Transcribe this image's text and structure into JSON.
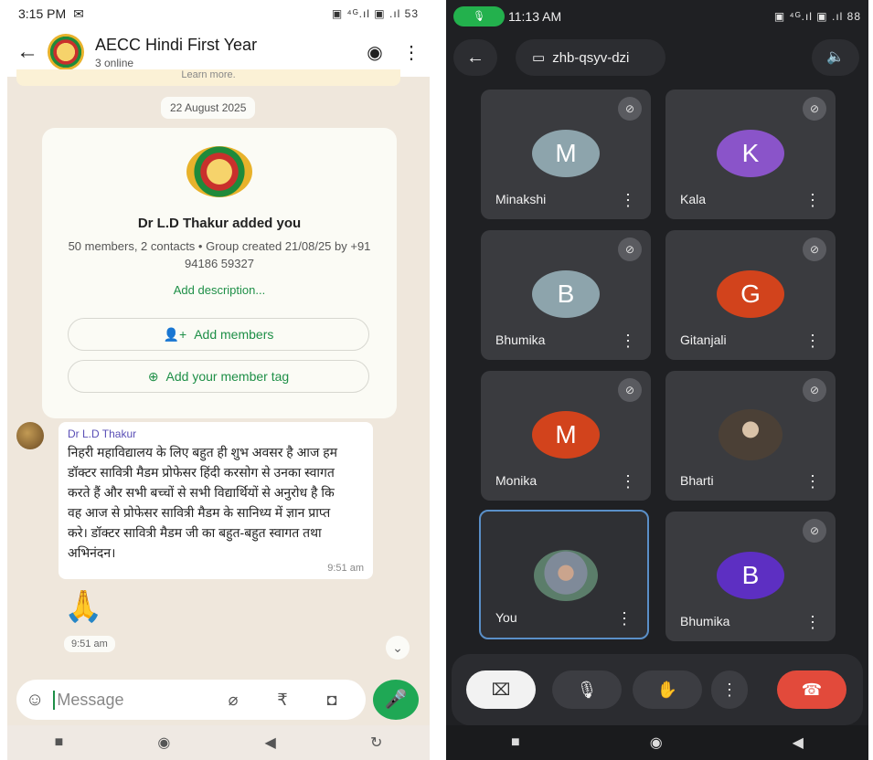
{
  "left": {
    "status": {
      "time": "3:15 PM",
      "icons": "▣ ⁴ᴳ.ıl ▣ .ıl 53"
    },
    "header": {
      "title": "AECC Hindi First Year",
      "subtitle": "3 online"
    },
    "banner_text": "Learn more.",
    "date_chip": "22 August 2025",
    "system_card": {
      "title": "Dr L.D Thakur added you",
      "meta": "50 members, 2 contacts • Group created 21/08/25 by +91 94186 59327",
      "add_description": "Add description...",
      "add_members": "Add members",
      "add_member_tag": "Add your member tag"
    },
    "message": {
      "sender": "Dr L.D Thakur",
      "text": "निहरी महाविद्यालय के लिए बहुत ही शुभ अवसर है आज हम डॉक्टर सावित्री मैडम प्रोफेसर हिंदी करसोग से उनका स्वागत करते हैं और सभी बच्चों से सभी विद्यार्थियों से अनुरोध है कि वह आज से प्रोफेसर सावित्री मैडम के सानिध्य में ज्ञान प्राप्त करे। डॉक्टर सावित्री मैडम जी का बहुत-बहुत स्वागत तथा अभिनंदन।",
      "time": "9:51 am"
    },
    "emoji_message": {
      "emoji": "🙏",
      "time": "9:51 am"
    },
    "input": {
      "placeholder": "Message"
    }
  },
  "right": {
    "status": {
      "time": "11:13 AM",
      "icons": "▣ ⁴ᴳ.ıl ▣ .ıl 88"
    },
    "meeting_code": "zhb-qsyv-dzi",
    "participants": [
      {
        "name": "Minakshi",
        "initial": "M",
        "color": "#8da4ac",
        "muted": true
      },
      {
        "name": "Kala",
        "initial": "K",
        "color": "#8a54c9",
        "muted": true
      },
      {
        "name": "Bhumika",
        "initial": "B",
        "color": "#8da4ac",
        "muted": true
      },
      {
        "name": "Gitanjali",
        "initial": "G",
        "color": "#d2431c",
        "muted": true
      },
      {
        "name": "Monika",
        "initial": "M",
        "color": "#d2431c",
        "muted": true
      },
      {
        "name": "Bharti",
        "initial": "",
        "color": "#4b4036",
        "muted": true
      },
      {
        "name": "You",
        "initial": "",
        "color": "#7f8a99",
        "muted": false
      },
      {
        "name": "Bhumika",
        "initial": "B",
        "color": "#5d2fc2",
        "muted": true
      }
    ]
  }
}
